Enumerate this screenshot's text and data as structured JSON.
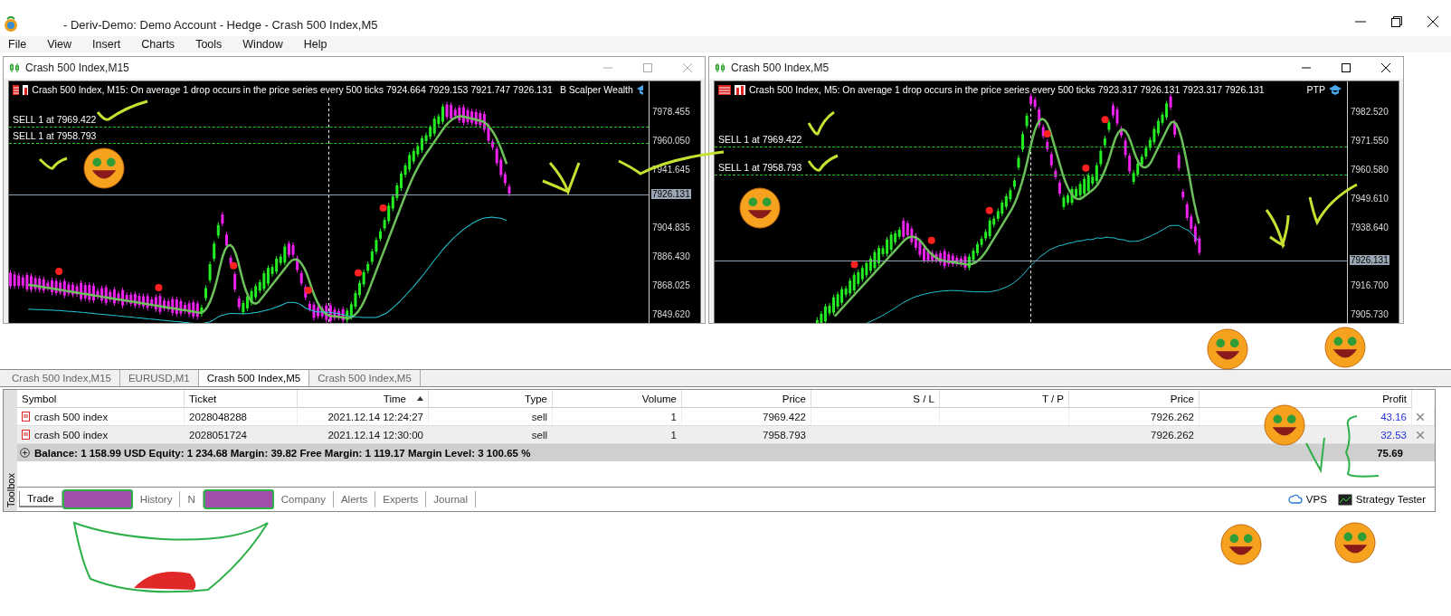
{
  "window": {
    "title": "- Deriv-Demo: Demo Account - Hedge - Crash 500 Index,M5"
  },
  "menu": [
    "File",
    "View",
    "Insert",
    "Charts",
    "Tools",
    "Window",
    "Help"
  ],
  "charts": [
    {
      "title": "Crash 500 Index,M15",
      "info": "Crash 500 Index, M15:  On average 1 drop occurs in the price series every 500 ticks  7924.664 7929.153 7921.747 7926.131",
      "expert": "B Scalper Wealth",
      "orders": [
        "SELL 1 at 7969.422",
        "SELL 1 at 7958.793"
      ],
      "axis": [
        {
          "kind": "tick",
          "label": "7978.455"
        },
        {
          "kind": "tick",
          "label": "7960.050"
        },
        {
          "kind": "tick",
          "label": "7941.645"
        },
        {
          "kind": "current",
          "label": "7926.131"
        },
        {
          "kind": "tick",
          "label": "7904.835"
        },
        {
          "kind": "tick",
          "label": "7886.430"
        },
        {
          "kind": "tick",
          "label": "7868.025"
        },
        {
          "kind": "tick",
          "label": "7849.620"
        }
      ]
    },
    {
      "title": "Crash 500 Index,M5",
      "info": "Crash 500 Index, M5:  On average 1 drop occurs in the price series every 500 ticks  7923.317 7926.131 7923.317 7926.131",
      "expert": "PTP",
      "orders": [
        "SELL 1 at 7969.422",
        "SELL 1 at 7958.793"
      ],
      "axis": [
        {
          "kind": "tick",
          "label": "7982.520"
        },
        {
          "kind": "tick",
          "label": "7971.550"
        },
        {
          "kind": "tick",
          "label": "7960.580"
        },
        {
          "kind": "tick",
          "label": "7949.610"
        },
        {
          "kind": "tick",
          "label": "7938.640"
        },
        {
          "kind": "current",
          "label": "7926.131"
        },
        {
          "kind": "tick",
          "label": "7916.700"
        },
        {
          "kind": "tick",
          "label": "7905.730"
        }
      ]
    }
  ],
  "chart_tabs": [
    {
      "label": "Crash 500 Index,M15",
      "selected": false
    },
    {
      "label": "EURUSD,M1",
      "selected": false
    },
    {
      "label": "Crash 500 Index,M5",
      "selected": true
    },
    {
      "label": "Crash 500 Index,M5",
      "selected": false
    }
  ],
  "table": {
    "columns": [
      "Symbol",
      "Ticket",
      "Time",
      "Type",
      "Volume",
      "Price",
      "S / L",
      "T / P",
      "Price",
      "Profit"
    ],
    "rows": [
      {
        "symbol": "crash 500 index",
        "ticket": "2028048288",
        "time": "2021.12.14 12:24:27",
        "type": "sell",
        "volume": "1",
        "price": "7969.422",
        "sl": "",
        "tp": "",
        "current": "7926.262",
        "profit": "43.16",
        "selected": false
      },
      {
        "symbol": "crash 500 index",
        "ticket": "2028051724",
        "time": "2021.12.14 12:30:00",
        "type": "sell",
        "volume": "1",
        "price": "7958.793",
        "sl": "",
        "tp": "",
        "current": "7926.262",
        "profit": "32.53",
        "selected": true
      }
    ],
    "summary": "Balance: 1 158.99 USD  Equity: 1 234.68  Margin: 39.82  Free Margin: 1 119.17  Margin Level: 3 100.65 %",
    "total": "75.69"
  },
  "toolbox_label": "Toolbox",
  "bottom_tabs": [
    {
      "kind": "tab",
      "label": "Trade",
      "selected": true
    },
    {
      "kind": "covered"
    },
    {
      "kind": "tab",
      "label": "History",
      "selected": false
    },
    {
      "kind": "tab",
      "label": "N",
      "selected": false
    },
    {
      "kind": "covered"
    },
    {
      "kind": "tab",
      "label": "Company",
      "selected": false
    },
    {
      "kind": "tab",
      "label": "Alerts",
      "selected": false
    },
    {
      "kind": "tab",
      "label": "Experts",
      "selected": false
    },
    {
      "kind": "tab",
      "label": "Journal",
      "selected": false
    }
  ],
  "bottom_right": [
    {
      "kind": "vps",
      "label": "VPS"
    },
    {
      "kind": "tester",
      "label": "Strategy Tester"
    }
  ]
}
